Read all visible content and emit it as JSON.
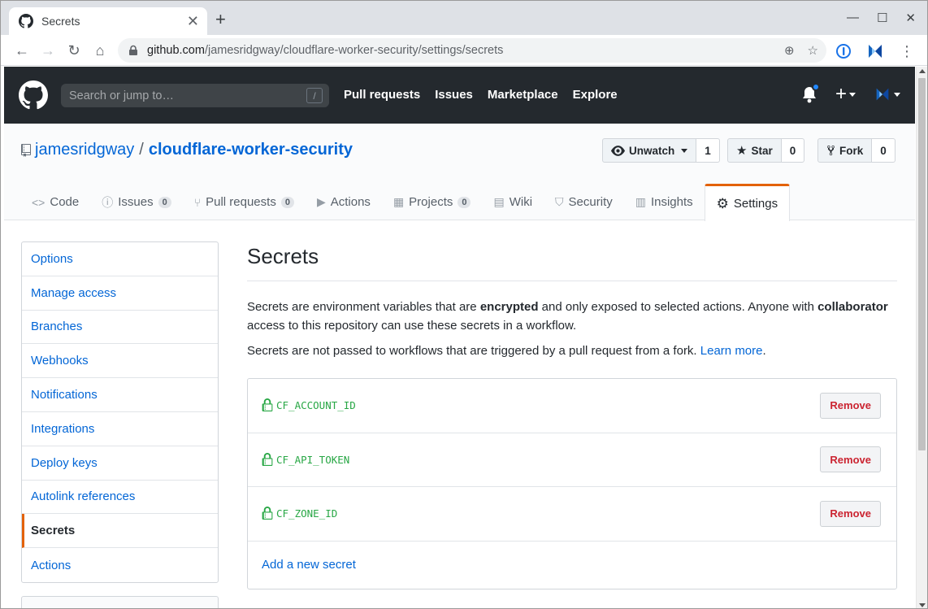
{
  "browser": {
    "tab_title": "Secrets",
    "url_host": "github.com",
    "url_path": "/jamesridgway/cloudflare-worker-security/settings/secrets"
  },
  "header": {
    "search_placeholder": "Search or jump to…",
    "search_key": "/",
    "nav": [
      "Pull requests",
      "Issues",
      "Marketplace",
      "Explore"
    ],
    "plus_label": "+"
  },
  "repo": {
    "owner": "jamesridgway",
    "separator": "/",
    "name": "cloudflare-worker-security",
    "watch": {
      "label": "Unwatch",
      "count": "1"
    },
    "star": {
      "label": "Star",
      "count": "0"
    },
    "fork": {
      "label": "Fork",
      "count": "0"
    }
  },
  "reponav": [
    {
      "label": "Code",
      "icon": "code-icon",
      "glyph": "<>"
    },
    {
      "label": "Issues",
      "badge": "0",
      "icon": "issue-icon",
      "glyph": "ⓘ"
    },
    {
      "label": "Pull requests",
      "badge": "0",
      "icon": "pull-request-icon",
      "glyph": "⑂"
    },
    {
      "label": "Actions",
      "icon": "play-icon",
      "glyph": "▶"
    },
    {
      "label": "Projects",
      "badge": "0",
      "icon": "project-icon",
      "glyph": "▦"
    },
    {
      "label": "Wiki",
      "icon": "book-icon",
      "glyph": "▤"
    },
    {
      "label": "Security",
      "icon": "shield-icon",
      "glyph": "⛉"
    },
    {
      "label": "Insights",
      "icon": "graph-icon",
      "glyph": "▥"
    },
    {
      "label": "Settings",
      "icon": "gear-icon",
      "glyph": "⚙"
    }
  ],
  "sidebar": {
    "items": [
      "Options",
      "Manage access",
      "Branches",
      "Webhooks",
      "Notifications",
      "Integrations",
      "Deploy keys",
      "Autolink references",
      "Secrets",
      "Actions"
    ],
    "selected": "Secrets"
  },
  "main": {
    "title": "Secrets",
    "desc_part1": "Secrets are environment variables that are ",
    "desc_bold1": "encrypted",
    "desc_part2": " and only exposed to selected actions. Anyone with ",
    "desc_bold2": "collaborator",
    "desc_part3": " access to this repository can use these secrets in a workflow.",
    "desc2_text": "Secrets are not passed to workflows that are triggered by a pull request from a fork. ",
    "learn_more": "Learn more",
    "desc2_end": ".",
    "secrets": [
      "CF_ACCOUNT_ID",
      "CF_API_TOKEN",
      "CF_ZONE_ID"
    ],
    "remove_label": "Remove",
    "add_secret": "Add a new secret"
  },
  "colors": {
    "header_bg": "#24292e",
    "link": "#0366d6",
    "secret_green": "#28a745",
    "danger": "#cb2431",
    "selected_accent": "#e36209"
  }
}
